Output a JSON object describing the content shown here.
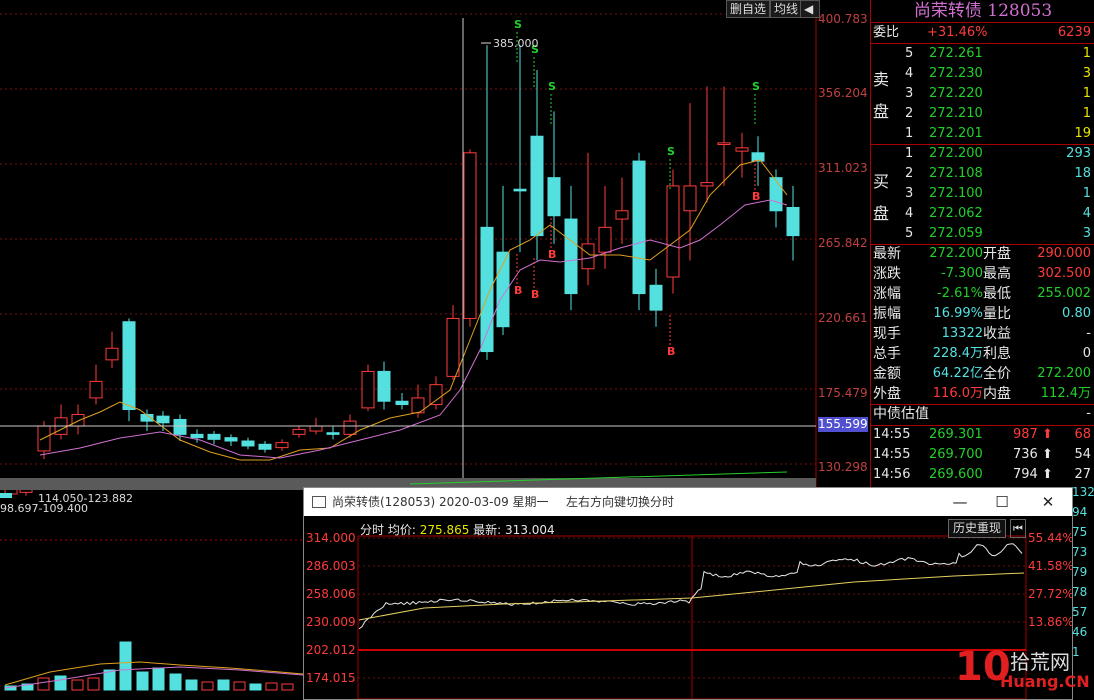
{
  "toolbar": {
    "delete_label": "删自选",
    "ma_label": "均线",
    "arrow_label": "◀"
  },
  "stock": {
    "name": "尚荣转债",
    "code": "128053",
    "title": "尚荣转债 128053"
  },
  "price_axis": [
    "400.783",
    "356.204",
    "311.023",
    "265.842",
    "220.661",
    "175.479",
    "130.298"
  ],
  "current_price_tag": "155.599",
  "annotations": {
    "high": "385.000",
    "range1": "114.050-123.882",
    "range2": "98.697-109.400",
    "s": "S",
    "b": "B"
  },
  "weibi": {
    "label": "委比",
    "pct": "+31.46%",
    "diff": "6239"
  },
  "sell_label": [
    "卖",
    "盘"
  ],
  "buy_label": [
    "买",
    "盘"
  ],
  "asks": [
    {
      "lvl": "5",
      "price": "272.261",
      "vol": "1"
    },
    {
      "lvl": "4",
      "price": "272.230",
      "vol": "3"
    },
    {
      "lvl": "3",
      "price": "272.220",
      "vol": "1"
    },
    {
      "lvl": "2",
      "price": "272.210",
      "vol": "1"
    },
    {
      "lvl": "1",
      "price": "272.201",
      "vol": "19"
    }
  ],
  "bids": [
    {
      "lvl": "1",
      "price": "272.200",
      "vol": "293"
    },
    {
      "lvl": "2",
      "price": "272.108",
      "vol": "18"
    },
    {
      "lvl": "3",
      "price": "272.100",
      "vol": "1"
    },
    {
      "lvl": "4",
      "price": "272.062",
      "vol": "4"
    },
    {
      "lvl": "5",
      "price": "272.059",
      "vol": "3"
    }
  ],
  "stats": [
    {
      "l1": "最新",
      "v1": "272.200",
      "l2": "开盘",
      "v2": "290.000",
      "c1": "green",
      "c2": "red"
    },
    {
      "l1": "涨跌",
      "v1": "-7.300",
      "l2": "最高",
      "v2": "302.500",
      "c1": "green",
      "c2": "red"
    },
    {
      "l1": "涨幅",
      "v1": "-2.61%",
      "l2": "最低",
      "v2": "255.002",
      "c1": "green",
      "c2": "green"
    },
    {
      "l1": "振幅",
      "v1": "16.99%",
      "l2": "量比",
      "v2": "0.80",
      "c1": "cyan",
      "c2": "cyan"
    },
    {
      "l1": "现手",
      "v1": "13322",
      "l2": "收益",
      "v2": "-",
      "c1": "cyan",
      "c2": "wht"
    },
    {
      "l1": "总手",
      "v1": "228.4万",
      "l2": "利息",
      "v2": "0",
      "c1": "cyan",
      "c2": "wht"
    },
    {
      "l1": "金额",
      "v1": "64.22亿",
      "l2": "全价",
      "v2": "272.200",
      "c1": "cyan",
      "c2": "green"
    },
    {
      "l1": "外盘",
      "v1": "116.0万",
      "l2": "内盘",
      "v2": "112.4万",
      "c1": "red",
      "c2": "green"
    }
  ],
  "zz_label": "中债估值",
  "zz_value": "-",
  "ticks": [
    {
      "time": "14:55",
      "price": "269.301",
      "vol": "987",
      "dir": "up",
      "n": "68",
      "c": "red"
    },
    {
      "time": "14:55",
      "price": "269.700",
      "vol": "736",
      "dir": "up",
      "n": "54",
      "c": "wht"
    },
    {
      "time": "14:56",
      "price": "269.600",
      "vol": "794",
      "dir": "up",
      "n": "27",
      "c": "wht"
    }
  ],
  "side_numbers": [
    "132",
    "94",
    "75",
    "73",
    "79",
    "78",
    "57",
    "46",
    "1"
  ],
  "popup": {
    "title": "尚荣转债(128053) 2020-03-09 星期一",
    "hint": "左右方向键切换分时",
    "info_label": "分时",
    "avg_label": "均价:",
    "avg_value": "275.865",
    "last_label": "最新:",
    "last_value": "313.004",
    "hist_button": "历史重现",
    "left_axis": [
      "314.000",
      "286.003",
      "258.006",
      "230.009",
      "202.012",
      "174.015"
    ],
    "right_axis": [
      "55.44%",
      "41.58%",
      "27.72%",
      "13.86%"
    ]
  },
  "watermark": {
    "brand": "10",
    "text1": "拾荒网",
    "text2": "Huang.CN"
  }
}
